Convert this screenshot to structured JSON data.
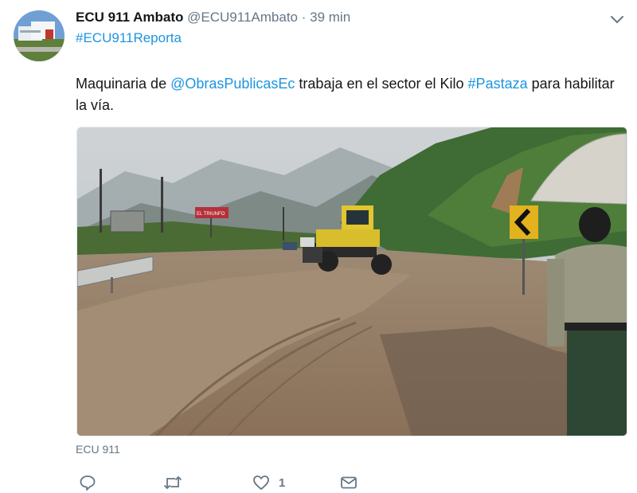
{
  "tweet": {
    "display_name": "ECU 911 Ambato",
    "handle": "@ECU911Ambato",
    "separator": "·",
    "time": "39 min",
    "tagline": "#ECU911Reporta",
    "text_parts": {
      "t1": "Maquinaria de ",
      "mention": "@ObrasPublicasEc",
      "t2": " trabaja en el sector el Kilo ",
      "hashtag": "#Pastaza",
      "t3": " para habilitar la vía."
    },
    "media_credit": "ECU 911",
    "like_count": "1",
    "sign_text": "EL TRIUNFO"
  },
  "icons": {
    "menu": "chevron-down-icon",
    "reply": "reply-icon",
    "retweet": "retweet-icon",
    "like": "heart-icon",
    "message": "envelope-icon"
  },
  "colors": {
    "link": "#1b95e0",
    "muted": "#657786",
    "text": "#14171a"
  }
}
